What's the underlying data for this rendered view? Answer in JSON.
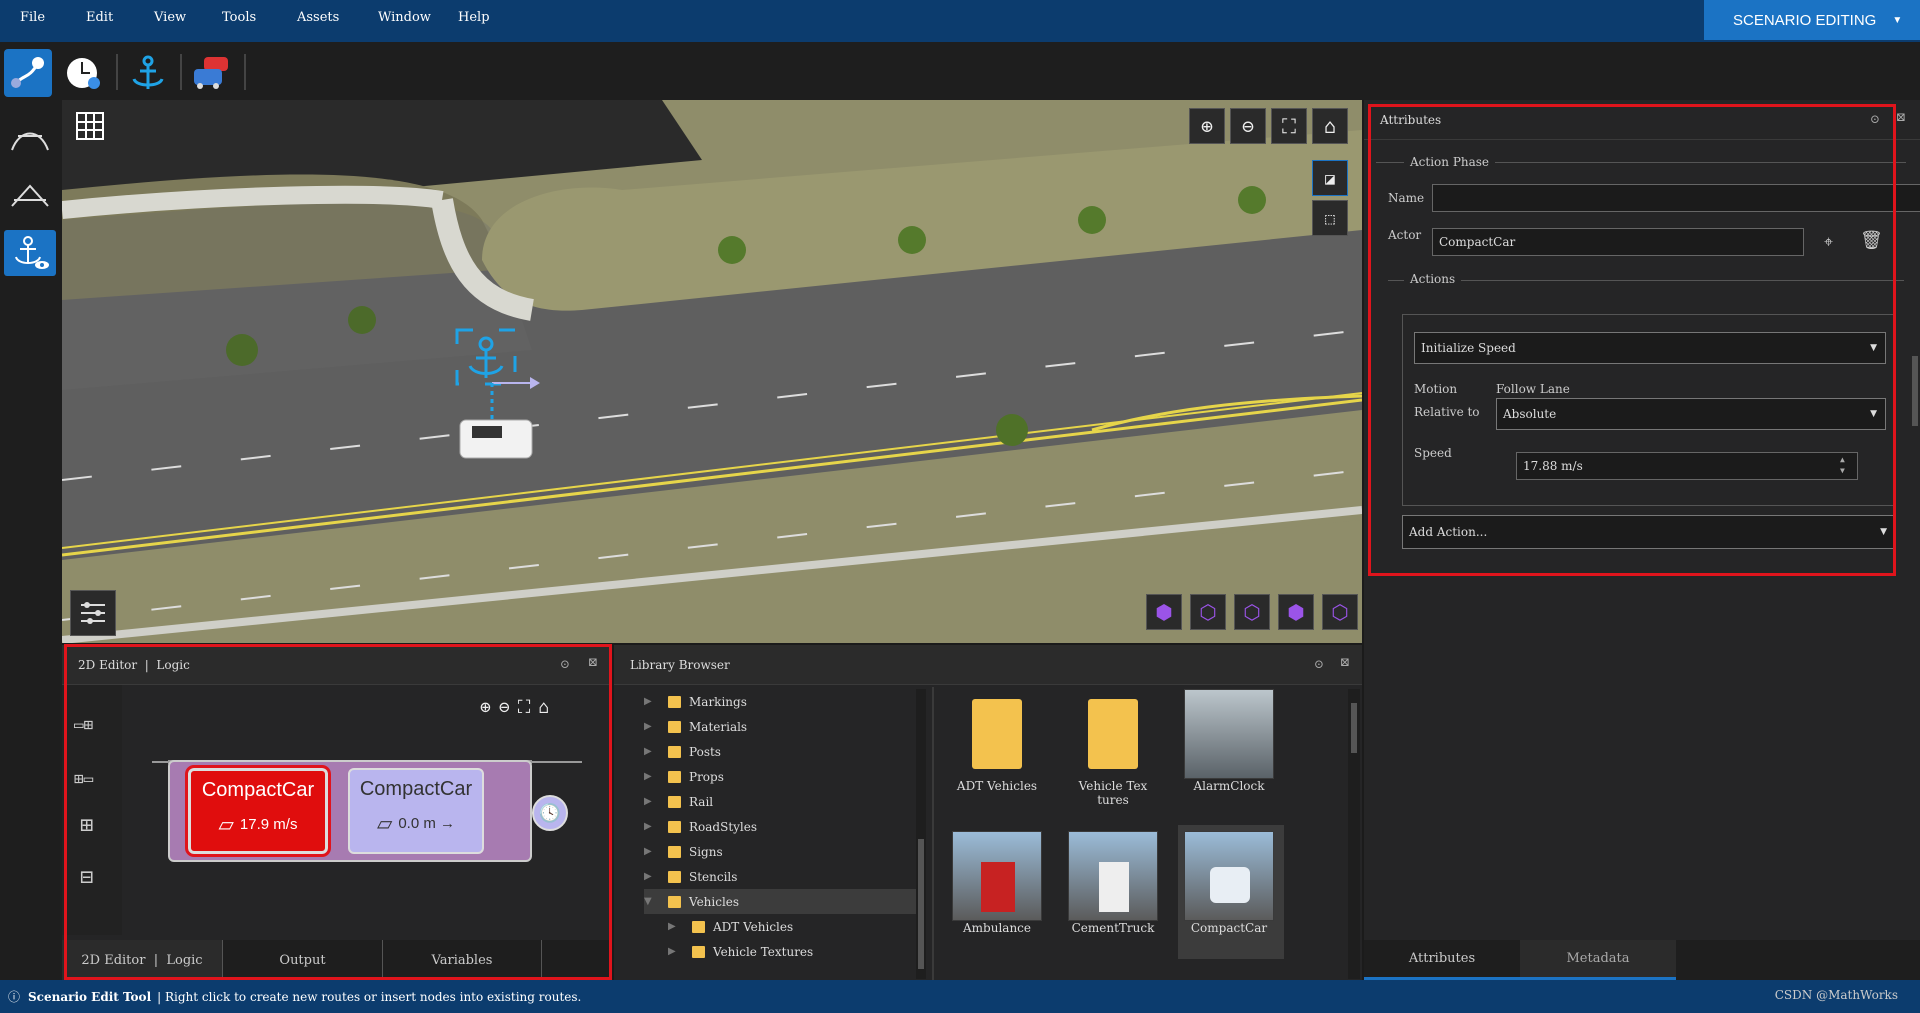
{
  "menu": [
    "File",
    "Edit",
    "View",
    "Tools",
    "Assets",
    "Window",
    "Help"
  ],
  "mode_selector": {
    "label": "SCENARIO EDITING"
  },
  "toolbar": {
    "icons": [
      "route-tool-icon",
      "time-trigger-icon",
      "anchor-icon",
      "vehicles-icon"
    ]
  },
  "left_tools": {
    "icons": [
      "curve-tool-icon",
      "polyline-tool-icon",
      "anchor-view-icon"
    ]
  },
  "viewport": {
    "icons": [
      "grid-icon",
      "zoom-in-icon",
      "zoom-out-icon",
      "fit-icon",
      "home-icon",
      "top-view-icon",
      "perspective-view-icon",
      "settings-sliders-icon",
      "cube-view-icons"
    ]
  },
  "editor2d": {
    "title": "2D Editor  |  Logic",
    "nodes": [
      {
        "actor": "CompactCar",
        "value": "17.9 m/s"
      },
      {
        "actor": "CompactCar",
        "value": "0.0 m →"
      }
    ],
    "tabs": [
      "2D Editor  |  Logic",
      "Output",
      "Variables"
    ]
  },
  "library": {
    "title": "Library Browser",
    "tree": [
      "Markings",
      "Materials",
      "Posts",
      "Props",
      "Rail",
      "RoadStyles",
      "Signs",
      "Stencils",
      "Vehicles"
    ],
    "subtree": [
      "ADT Vehicles",
      "Vehicle Textures"
    ],
    "items": [
      "ADT Vehicles",
      "Vehicle Tex\ntures",
      "AlarmClock",
      "Ambulance",
      "CementTruck",
      "CompactCar"
    ]
  },
  "attributes": {
    "title": "Attributes",
    "group": "Action Phase",
    "name_label": "Name",
    "name_value": "",
    "actor_label": "Actor",
    "actor_value": "CompactCar",
    "actions_label": "Actions",
    "action_type": "Initialize Speed",
    "motion_label": "Motion",
    "motion_value": "Follow Lane",
    "relative_label": "Relative to",
    "relative_value": "Absolute",
    "speed_label": "Speed",
    "speed_value": "17.88 m/s",
    "add_action": "Add Action...",
    "tabs": [
      "Attributes",
      "Metadata"
    ]
  },
  "status": {
    "tool": "Scenario Edit Tool",
    "message": "| Right click to create new routes or insert nodes into existing routes.",
    "watermark": "CSDN @MathWorks"
  },
  "colors": {
    "menubar": "#0c3c6e",
    "accent": "#1b73c4",
    "highlight": "#e0141c",
    "folder": "#f3c24e",
    "node_selected": "#e00d0d",
    "node": "#b9b5ee"
  }
}
